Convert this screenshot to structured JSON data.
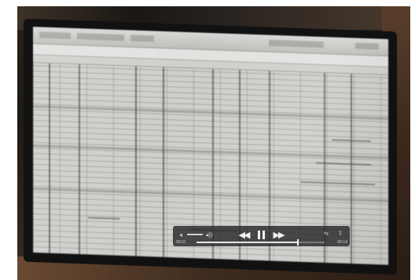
{
  "player": {
    "time_elapsed": "00:01",
    "time_remaining": "-00:14",
    "progress": 0.79
  },
  "icons": {
    "volume_min": "speaker-low-icon",
    "volume_max": "speaker-high-icon",
    "rewind": "rewind-icon",
    "pause": "pause-icon",
    "fast_forward": "fast-forward-icon",
    "loop": "loop-icon",
    "share": "share-icon"
  },
  "glyphs": {
    "volume_min": "◂",
    "volume_max": "◂))",
    "rewind": "◀◀",
    "fast_forward": "▶▶",
    "loop": "⇆",
    "share": "⇧"
  }
}
